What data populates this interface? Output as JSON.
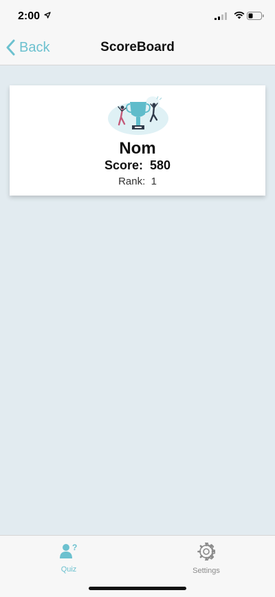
{
  "status_bar": {
    "time": "2:00"
  },
  "nav": {
    "back_label": "Back",
    "title": "ScoreBoard"
  },
  "card": {
    "name": "Nom",
    "score_label": "Score:",
    "score_value": "580",
    "rank_label": "Rank:",
    "rank_value": "1"
  },
  "tabs": [
    {
      "label": "Quiz",
      "icon": "quiz-user-icon",
      "active": true
    },
    {
      "label": "Settings",
      "icon": "gear-icon",
      "active": false
    }
  ],
  "colors": {
    "accent": "#6cc1cf",
    "background": "#e2ebf0",
    "bar": "#f7f7f7"
  }
}
